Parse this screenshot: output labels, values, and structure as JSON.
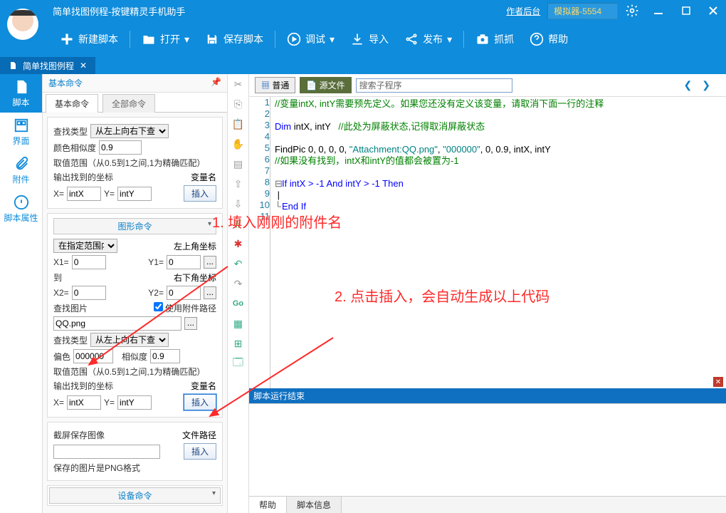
{
  "title": "简单找图例程-按键精灵手机助手",
  "links": {
    "author": "作者后台",
    "emulator": "模拟器-5554"
  },
  "toolbar": {
    "new": "新建脚本",
    "open": "打开",
    "save": "保存脚本",
    "debug": "调试",
    "import": "导入",
    "publish": "发布",
    "capture": "抓抓",
    "help": "帮助"
  },
  "tab": {
    "title": "简单找图例程"
  },
  "leftnav": {
    "script": "脚本",
    "ui": "界面",
    "attach": "附件",
    "props": "脚本属性"
  },
  "panel": {
    "title": "基本命令",
    "tabs": {
      "basic": "基本命令",
      "all": "全部命令"
    }
  },
  "sec1": {
    "searchType": "查找类型",
    "searchTypeVal": "从左上向右下查找",
    "colorSim": "颜色相似度",
    "colorSimVal": "0.9",
    "range": "取值范围（从0.5到1之间,1为精确匹配）",
    "outCoord": "输出找到的坐标",
    "varName": "变量名",
    "x": "X=",
    "xVal": "intX",
    "y": "Y=",
    "yVal": "intY",
    "insert": "插入"
  },
  "sec2": {
    "title": "图形命令",
    "rangeSel": "在指定范围内",
    "tl": "左上角坐标",
    "x1": "X1=",
    "x1v": "0",
    "y1": "Y1=",
    "y1v": "0",
    "to": "到",
    "br": "右下角坐标",
    "x2": "X2=",
    "x2v": "0",
    "y2": "Y2=",
    "y2v": "0",
    "findImg": "查找图片",
    "useAttach": "使用附件路径",
    "imgName": "QQ.png",
    "searchType": "查找类型",
    "searchTypeVal": "从左上向右下查找",
    "bias": "偏色",
    "biasVal": "000000",
    "sim": "相似度",
    "simVal": "0.9",
    "range": "取值范围（从0.5到1之间,1为精确匹配）",
    "outCoord": "输出找到的坐标",
    "varName": "变量名",
    "x": "X=",
    "xVal": "intX",
    "y": "Y=",
    "yVal": "intY",
    "insert": "插入"
  },
  "sec3": {
    "screenshotLabel": "截屏保存图像",
    "pathLabel": "文件路径",
    "insert": "插入",
    "note": "保存的图片是PNG格式"
  },
  "sec4": {
    "title": "设备命令"
  },
  "editor": {
    "viewNormal": "普通",
    "viewSource": "源文件",
    "searchPlaceholder": "搜索子程序",
    "line1": "//变量intX, intY需要预先定义。如果您还没有定义该变量，请取消下面一行的注释",
    "line3a": "Dim",
    "line3b": " intX, intY   ",
    "line3c": "//此处为屏蔽状态,记得取消屏蔽状态",
    "line5a": "FindPic 0, 0, 0, 0, ",
    "line5b": "\"Attachment:QQ.png\"",
    "line5c": ", ",
    "line5d": "\"000000\"",
    "line5e": ", 0, 0.9, intX, intY",
    "line6": "//如果没有找到，intX和intY的值都会被置为-1",
    "line8": "If intX > -1 And intY > -1 Then",
    "line10": "End If"
  },
  "results": {
    "title": "脚本运行结束",
    "help": "帮助",
    "info": "脚本信息"
  },
  "annotations": {
    "a1": "1. 填入刚刚的附件名",
    "a2": "2. 点击插入，会自动生成以上代码"
  }
}
